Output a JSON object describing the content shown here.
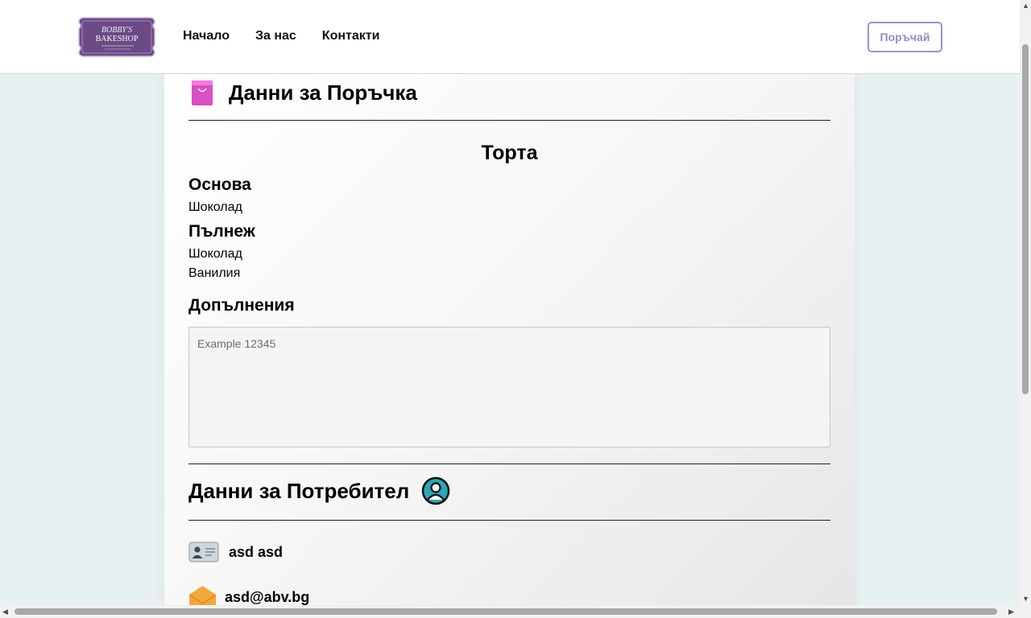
{
  "nav": {
    "logo": {
      "line1": "BOBBY'S",
      "line2": "BAKESHOP"
    },
    "links": [
      "Начало",
      "За нас",
      "Контакти"
    ],
    "order_button": "Поръчай"
  },
  "order": {
    "title": "Данни за Поръчка",
    "product": "Торта",
    "base_label": "Основа",
    "base_value": "Шоколад",
    "filling_label": "Пълнеж",
    "fillings": [
      "Шоколад",
      "Ванилия"
    ],
    "extras_label": "Допълнения",
    "extras_placeholder": "Example 12345",
    "extras_value": ""
  },
  "user": {
    "title": "Данни за Потребител",
    "name": "asd asd",
    "email": "asd@abv.bg"
  },
  "colors": {
    "accent": "#9a87c8",
    "logo_bg": "#6b4a86",
    "bag_icon": "#d94fc4",
    "user_icon": "#2ba7b7",
    "background": "#e8f1f2"
  },
  "icons": [
    "shopping-bag-icon",
    "user-circle-icon",
    "id-card-icon",
    "envelope-icon"
  ]
}
